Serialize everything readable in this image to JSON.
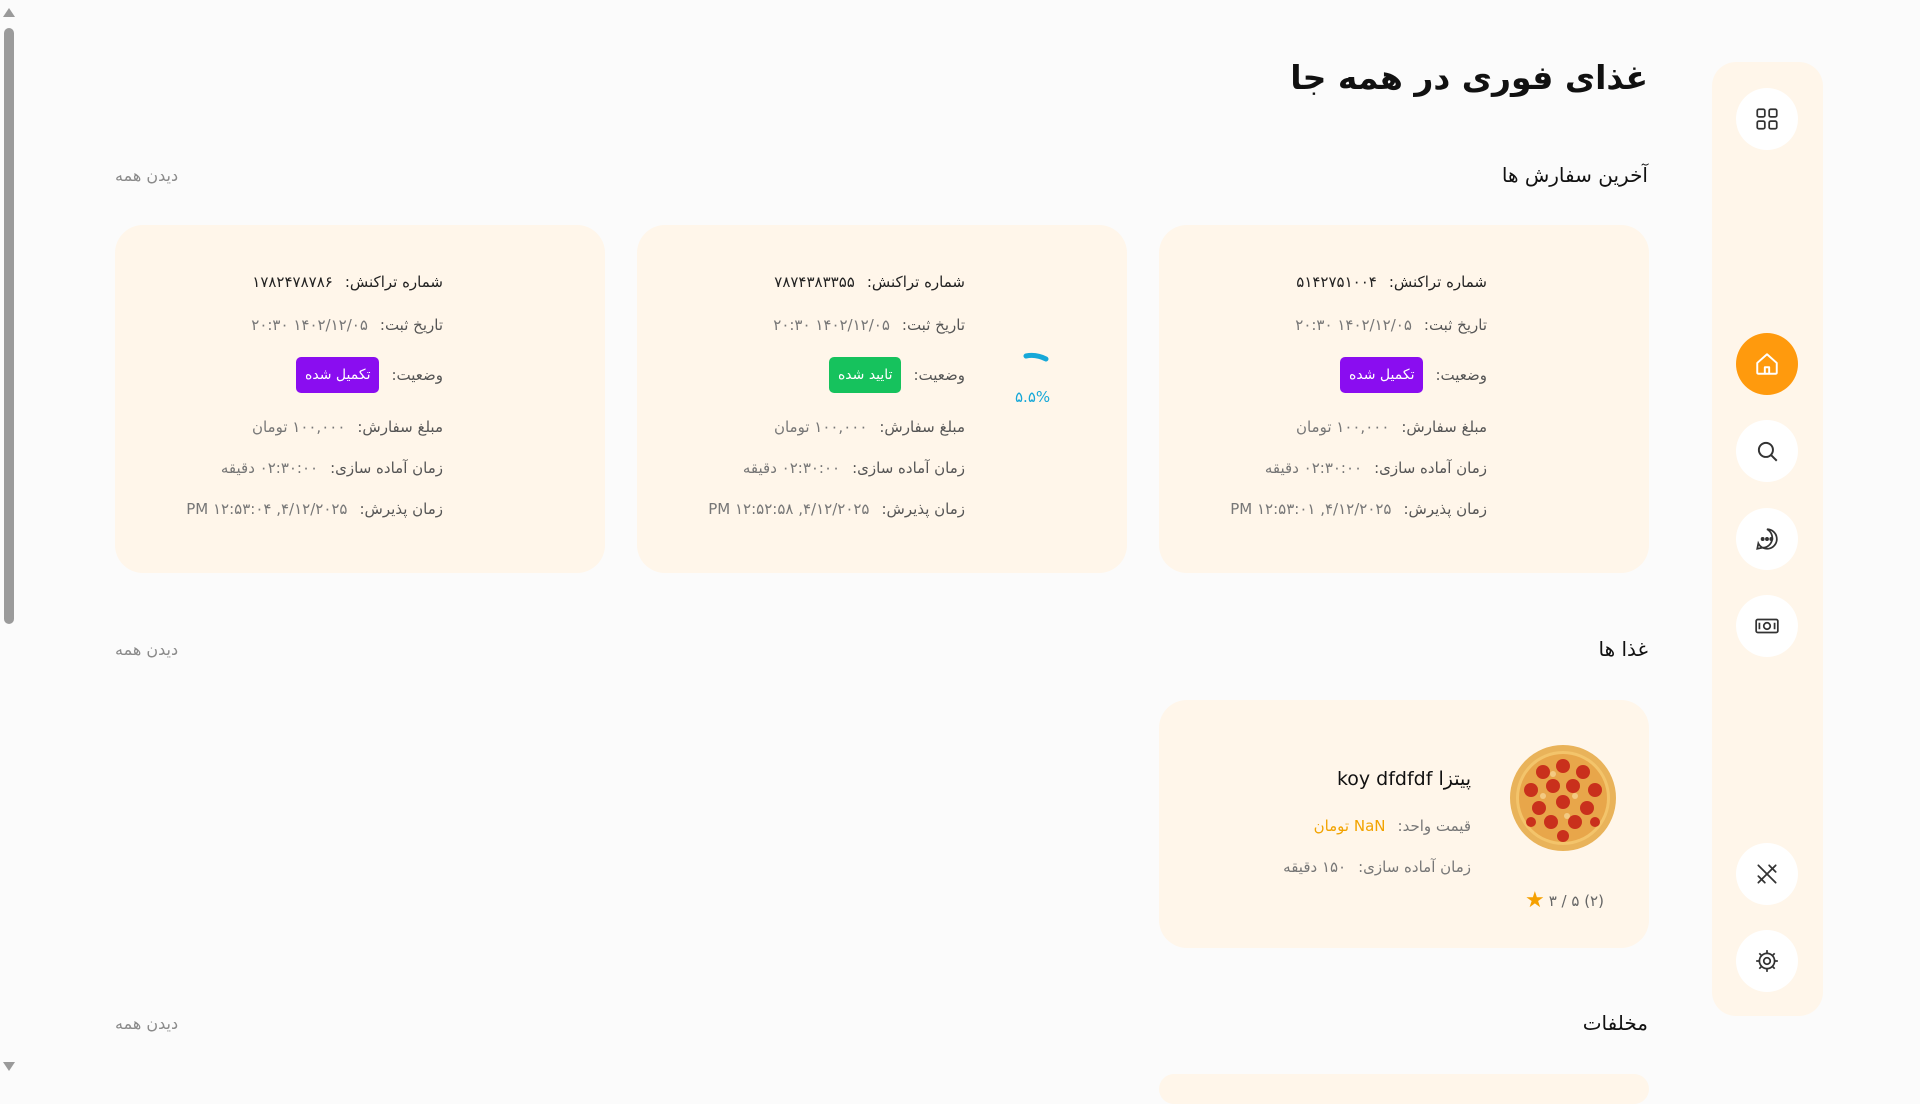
{
  "page_title": "غذای فوری در همه جا",
  "sections": {
    "orders": {
      "title": "آخرین سفارش ها",
      "see_all": "دیدن همه"
    },
    "foods": {
      "title": "غذا ها",
      "see_all": "دیدن همه"
    },
    "extras": {
      "title": "مخلفات",
      "see_all": "دیدن همه"
    }
  },
  "labels": {
    "transaction": "شماره تراکنش:",
    "date": "تاریخ ثبت:",
    "status": "وضعیت:",
    "amount": "مبلغ سفارش:",
    "prep_time": "زمان آماده سازی:",
    "accept_time": "زمان پذیرش:",
    "unit_price": "قیمت واحد:",
    "food_prep": "زمان آماده سازی:"
  },
  "orders": [
    {
      "transaction": "۵۱۴۲۷۵۱۰۰۴",
      "date": "۱۴۰۲/۱۲/۰۵ ۲۰:۳۰",
      "status": "تکمیل شده",
      "status_color": "#8a0df0",
      "amount": "۱۰۰,۰۰۰ تومان",
      "prep_time": "۰۲:۳۰:۰۰ دقیقه",
      "accept_time": "۴/۱۲/۲۰۲۵, ۱۲:۵۳:۰۱ PM"
    },
    {
      "transaction": "۷۸۷۴۳۸۳۳۵۵",
      "date": "۱۴۰۲/۱۲/۰۵ ۲۰:۳۰",
      "status": "تایید شده",
      "status_color": "#16c25d",
      "amount": "۱۰۰,۰۰۰ تومان",
      "prep_time": "۰۲:۳۰:۰۰ دقیقه",
      "accept_time": "۴/۱۲/۲۰۲۵, ۱۲:۵۲:۵۸ PM",
      "progress_text": "۵.۵%",
      "progress": 0.055
    },
    {
      "transaction": "۱۷۸۲۴۷۸۷۸۶",
      "date": "۱۴۰۲/۱۲/۰۵ ۲۰:۳۰",
      "status": "تکمیل شده",
      "status_color": "#8a0df0",
      "amount": "۱۰۰,۰۰۰ تومان",
      "prep_time": "۰۲:۳۰:۰۰ دقیقه",
      "accept_time": "۴/۱۲/۲۰۲۵, ۱۲:۵۳:۰۴ PM"
    }
  ],
  "food": {
    "name": "پیتزا koy dfdfdf",
    "unit_price": "NaN تومان",
    "prep_time": "۱۵۰ دقیقه",
    "rating": "۳ / ۵ (۲)"
  },
  "sidebar": {
    "items": [
      {
        "icon": "grid-icon",
        "active": false
      },
      {
        "icon": "home-icon",
        "active": true
      },
      {
        "icon": "search-icon",
        "active": false
      },
      {
        "icon": "chat-icon",
        "active": false
      },
      {
        "icon": "money-icon",
        "active": false
      },
      {
        "icon": "utensils-icon",
        "active": false
      },
      {
        "icon": "settings-icon",
        "active": false
      }
    ]
  },
  "colors": {
    "accent": "#ff9a0d",
    "card_bg": "#fff6ea",
    "completed": "#8a0df0",
    "approved": "#16c25d",
    "progress": "#17a8d8",
    "price": "#f2a300"
  }
}
